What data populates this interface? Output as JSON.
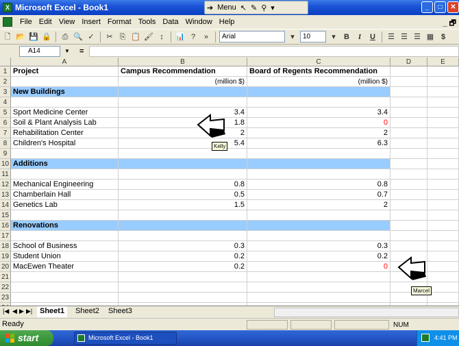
{
  "window": {
    "title": "Microsoft Excel - Book1",
    "floating_menu_label": "Menu"
  },
  "menubar": {
    "items": [
      "File",
      "Edit",
      "View",
      "Insert",
      "Format",
      "Tools",
      "Data",
      "Window",
      "Help"
    ]
  },
  "toolbar": {
    "font_name": "Arial",
    "font_size": "10"
  },
  "formula_bar": {
    "cell_ref": "A14",
    "equals": "=",
    "content": ""
  },
  "columns": [
    "A",
    "B",
    "C",
    "D",
    "E"
  ],
  "rows": [
    {
      "n": "1",
      "type": "hdr",
      "a": "Project",
      "b": "Campus Recommendation",
      "c": "Board of Regents Recommendation",
      "b_red": false,
      "c_red": false
    },
    {
      "n": "2",
      "type": "unit",
      "a": "",
      "b": "(million $)",
      "c": "(million $)",
      "b_red": false,
      "c_red": false
    },
    {
      "n": "3",
      "type": "section",
      "a": "New Buildings",
      "b": "",
      "c": "",
      "b_red": false,
      "c_red": false
    },
    {
      "n": "4",
      "type": "blank",
      "a": "",
      "b": "",
      "c": "",
      "b_red": false,
      "c_red": false
    },
    {
      "n": "5",
      "type": "data",
      "a": "Sport Medicine Center",
      "b": "3.4",
      "c": "3.4",
      "b_red": false,
      "c_red": false
    },
    {
      "n": "6",
      "type": "data",
      "a": "Soil & Plant Analysis Lab",
      "b": "1.8",
      "c": "0",
      "b_red": false,
      "c_red": true
    },
    {
      "n": "7",
      "type": "data",
      "a": "Rehabilitation Center",
      "b": "2",
      "c": "2",
      "b_red": false,
      "c_red": false
    },
    {
      "n": "8",
      "type": "data",
      "a": "Children's Hospital",
      "b": "5.4",
      "c": "6.3",
      "b_red": false,
      "c_red": false
    },
    {
      "n": "9",
      "type": "blank",
      "a": "",
      "b": "",
      "c": "",
      "b_red": false,
      "c_red": false
    },
    {
      "n": "10",
      "type": "section",
      "a": "Additions",
      "b": "",
      "c": "",
      "b_red": false,
      "c_red": false
    },
    {
      "n": "11",
      "type": "blank",
      "a": "",
      "b": "",
      "c": "",
      "b_red": false,
      "c_red": false
    },
    {
      "n": "12",
      "type": "data",
      "a": "Mechanical Engineering",
      "b": "0.8",
      "c": "0.8",
      "b_red": false,
      "c_red": false
    },
    {
      "n": "13",
      "type": "data",
      "a": "Chamberlain Hall",
      "b": "0.5",
      "c": "0.7",
      "b_red": false,
      "c_red": false
    },
    {
      "n": "14",
      "type": "data",
      "a": "Genetics Lab",
      "b": "1.5",
      "c": "2",
      "b_red": false,
      "c_red": false
    },
    {
      "n": "15",
      "type": "blank",
      "a": "",
      "b": "",
      "c": "",
      "b_red": false,
      "c_red": false
    },
    {
      "n": "16",
      "type": "section",
      "a": "Renovations",
      "b": "",
      "c": "",
      "b_red": false,
      "c_red": false
    },
    {
      "n": "17",
      "type": "blank",
      "a": "",
      "b": "",
      "c": "",
      "b_red": false,
      "c_red": false
    },
    {
      "n": "18",
      "type": "data",
      "a": "School of Business",
      "b": "0.3",
      "c": "0.3",
      "b_red": false,
      "c_red": false
    },
    {
      "n": "19",
      "type": "data",
      "a": "Student Union",
      "b": "0.2",
      "c": "0.2",
      "b_red": false,
      "c_red": false
    },
    {
      "n": "20",
      "type": "data",
      "a": "MacEwen Theater",
      "b": "0.2",
      "c": "0",
      "b_red": false,
      "c_red": true
    },
    {
      "n": "21",
      "type": "blank",
      "a": "",
      "b": "",
      "c": "",
      "b_red": false,
      "c_red": false
    },
    {
      "n": "22",
      "type": "blank",
      "a": "",
      "b": "",
      "c": "",
      "b_red": false,
      "c_red": false
    },
    {
      "n": "23",
      "type": "blank",
      "a": "",
      "b": "",
      "c": "",
      "b_red": false,
      "c_red": false
    },
    {
      "n": "24",
      "type": "blank",
      "a": "",
      "b": "",
      "c": "",
      "b_red": false,
      "c_red": false
    }
  ],
  "annotations": {
    "note_kelly": "Kelly",
    "note_marcel": "Marcel"
  },
  "sheet_tabs": [
    "Sheet1",
    "Sheet2",
    "Sheet3"
  ],
  "status": {
    "left": "Ready",
    "num": "NUM"
  },
  "taskbar": {
    "start_label": "start",
    "task_item": "Microsoft Excel - Book1",
    "clock": "4:41 PM"
  },
  "colors": {
    "section_fill": "#99ccff",
    "highlight_red": "#ff0000",
    "title_blue": "#0a3fc2"
  }
}
